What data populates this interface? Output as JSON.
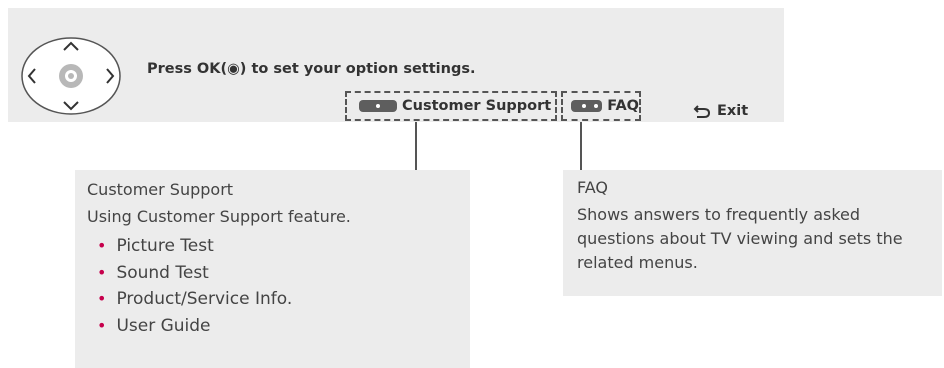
{
  "panel": {
    "instruction": "Press OK(◉) to set your option settings.",
    "customer_support_label": "Customer Support",
    "faq_label": "FAQ",
    "exit_label": "Exit"
  },
  "callouts": {
    "customer_support": {
      "title": "Customer Support",
      "description": "Using Customer Support feature.",
      "items": [
        "Picture Test",
        "Sound Test",
        "Product/Service Info.",
        "User Guide"
      ]
    },
    "faq": {
      "title": "FAQ",
      "description": "Shows answers to frequently asked questions about TV viewing and sets the related menus."
    }
  },
  "colors": {
    "panel_bg": "#ececec",
    "bullet": "#c6004c",
    "key": "#5e5e5e"
  },
  "icons": {
    "nav": "navigation-wheel-icon",
    "exit": "return-arrow-icon"
  }
}
